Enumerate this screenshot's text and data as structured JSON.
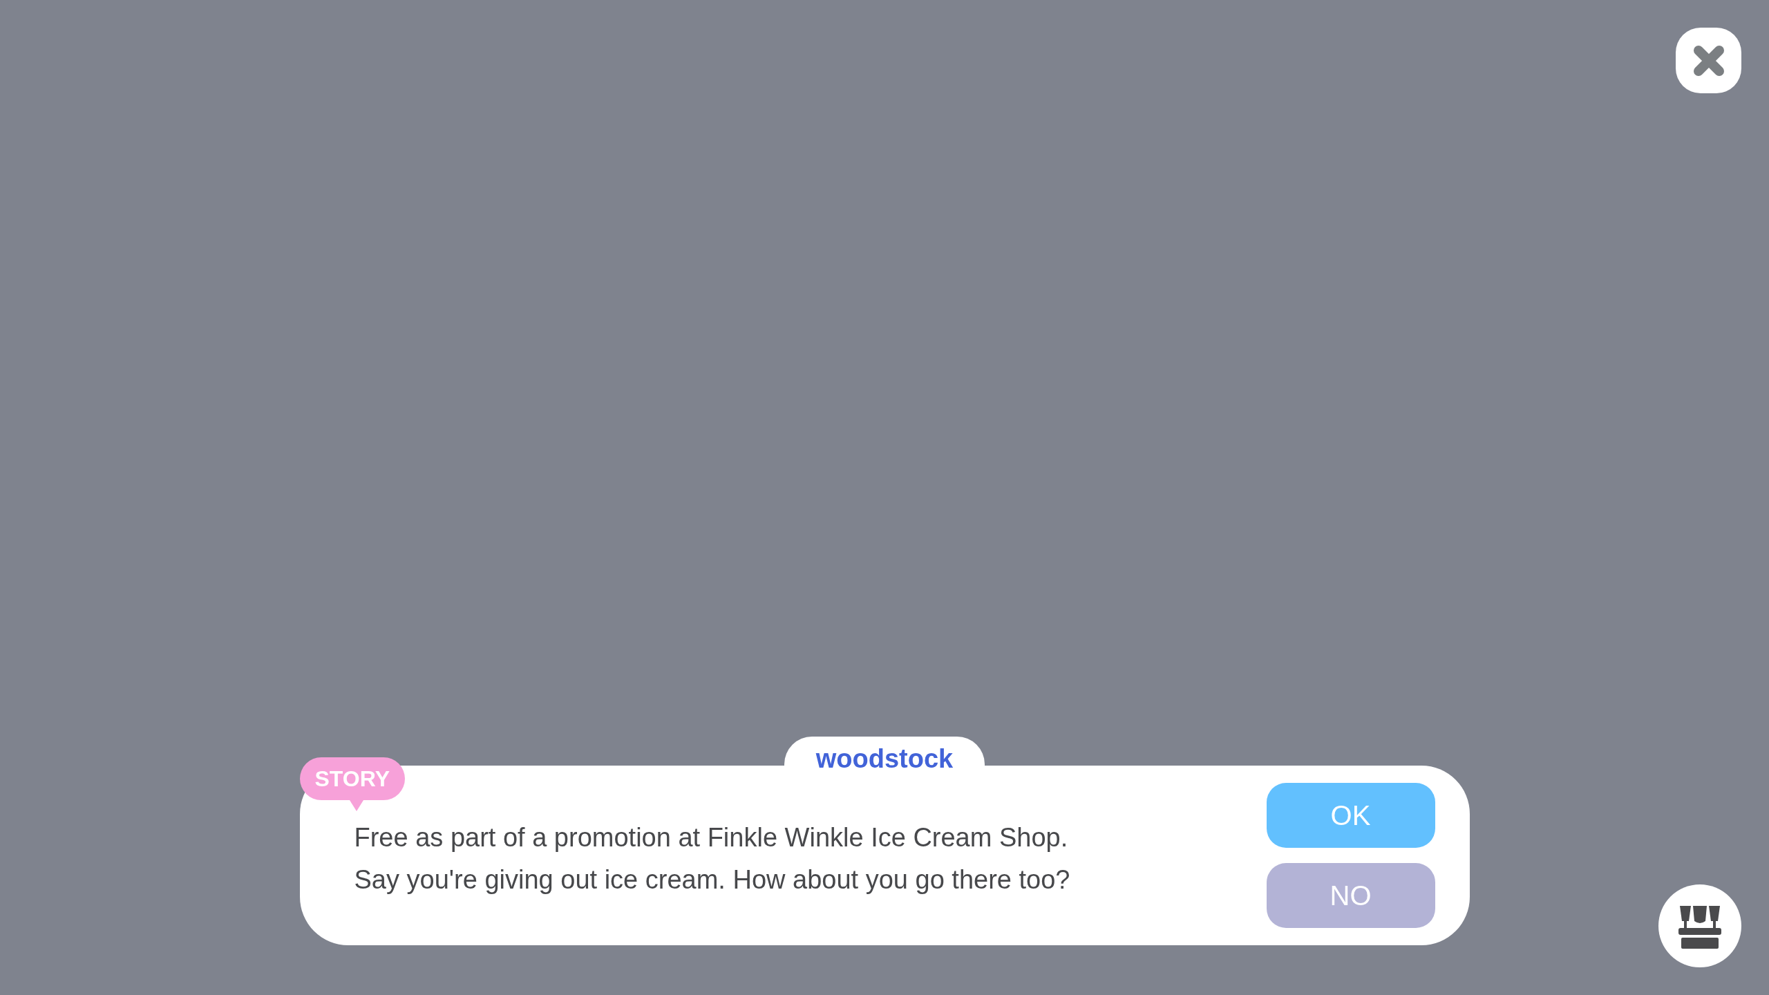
{
  "dialog": {
    "badge": "STORY",
    "speaker": "woodstock",
    "lines": [
      "Free as part of a promotion at Finkle Winkle Ice Cream Shop.",
      "Say you're giving out ice cream. How about you go there too?"
    ],
    "buttons": [
      {
        "label": "OK",
        "kind": "confirm"
      },
      {
        "label": "NO",
        "kind": "cancel"
      }
    ]
  }
}
